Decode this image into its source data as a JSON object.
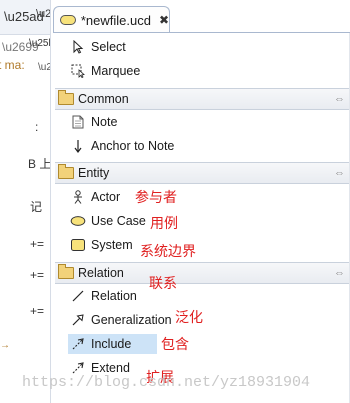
{
  "editor_tab": {
    "title": "*newfile.ucd",
    "close": "✖"
  },
  "left_pane": {
    "clipped_text": "t ma:",
    "marks": [
      ":",
      "B 上",
      "记",
      "+=",
      "+=",
      "+=",
      "→"
    ]
  },
  "palette": {
    "tools": [
      {
        "label": "Select",
        "icon": "select-arrow-icon"
      },
      {
        "label": "Marquee",
        "icon": "marquee-icon"
      }
    ],
    "drawers": [
      {
        "label": "Common",
        "icon": "folder-open-icon",
        "pin": "⇔",
        "items": [
          {
            "label": "Note",
            "icon": "note-icon"
          },
          {
            "label": "Anchor to Note",
            "icon": "anchor-arrow-icon"
          }
        ]
      },
      {
        "label": "Entity",
        "icon": "folder-open-icon",
        "pin": "⇔",
        "items": [
          {
            "label": "Actor",
            "icon": "actor-icon",
            "annotation": "参与者"
          },
          {
            "label": "Use Case",
            "icon": "usecase-ellipse-icon",
            "annotation": "用例"
          },
          {
            "label": "System",
            "icon": "system-box-icon",
            "annotation": "系统边界"
          }
        ]
      },
      {
        "label": "Relation",
        "icon": "folder-open-icon",
        "pin": "⇔",
        "annotation": "联系",
        "items": [
          {
            "label": "Relation",
            "icon": "line-icon"
          },
          {
            "label": "Generalization",
            "icon": "generalization-arrow-icon",
            "annotation": "泛化"
          },
          {
            "label": "Include",
            "icon": "include-dashed-arrow-icon",
            "annotation": "包含",
            "selected": true
          },
          {
            "label": "Extend",
            "icon": "extend-dashed-arrow-icon",
            "annotation": "扩展"
          }
        ]
      }
    ]
  },
  "watermark": "https://blog.csdn.net/yz18931904",
  "colors": {
    "annotation": "#e02020",
    "selection": "#cde3f7",
    "folder": "#f2d27a",
    "header": "#e9ecf1"
  }
}
